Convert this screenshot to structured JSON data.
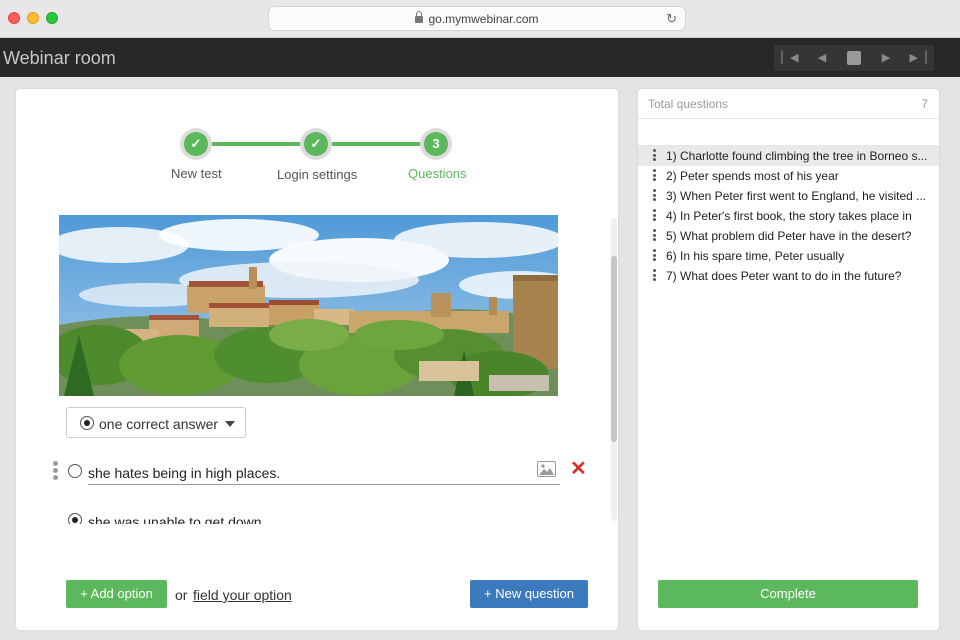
{
  "browser": {
    "url": "go.mymwebinar.com",
    "icons": [
      "lock-icon",
      "reload-icon"
    ]
  },
  "header": {
    "title": "Webinar room",
    "player_icons": [
      "skip-back-icon",
      "previous-icon",
      "stop-icon",
      "next-icon",
      "skip-forward-icon"
    ]
  },
  "stepper": {
    "steps": [
      {
        "label": "New test",
        "state": "done",
        "symbol": "✓"
      },
      {
        "label": "Login settings",
        "state": "done",
        "symbol": "✓"
      },
      {
        "label": "Questions",
        "state": "active",
        "symbol": "3"
      }
    ]
  },
  "question": {
    "answer_type": "one correct answer",
    "options": [
      {
        "text": "she hates being in high places.",
        "selected": false
      },
      {
        "text": "she was unable to get down",
        "selected": true
      }
    ]
  },
  "actions": {
    "add_option": "+ Add option",
    "or": "or",
    "field_option": "field your option",
    "new_question": "+ New question"
  },
  "sidebar": {
    "title": "Total questions",
    "count": "7",
    "items": [
      "1) Charlotte found climbing the tree in Borneo s...",
      "2) Peter spends most of his year",
      "3) When Peter first went to England, he visited ...",
      "4) In Peter's first book, the story takes place in",
      "5) What problem did Peter have in the desert?",
      "6) In his spare time, Peter usually",
      "7) What does Peter want to do in the future?"
    ],
    "complete": "Complete"
  },
  "colors": {
    "accent_green": "#5cb85c",
    "accent_blue": "#3a7abd",
    "delete_red": "#d9302c",
    "header_bg": "#282828"
  }
}
